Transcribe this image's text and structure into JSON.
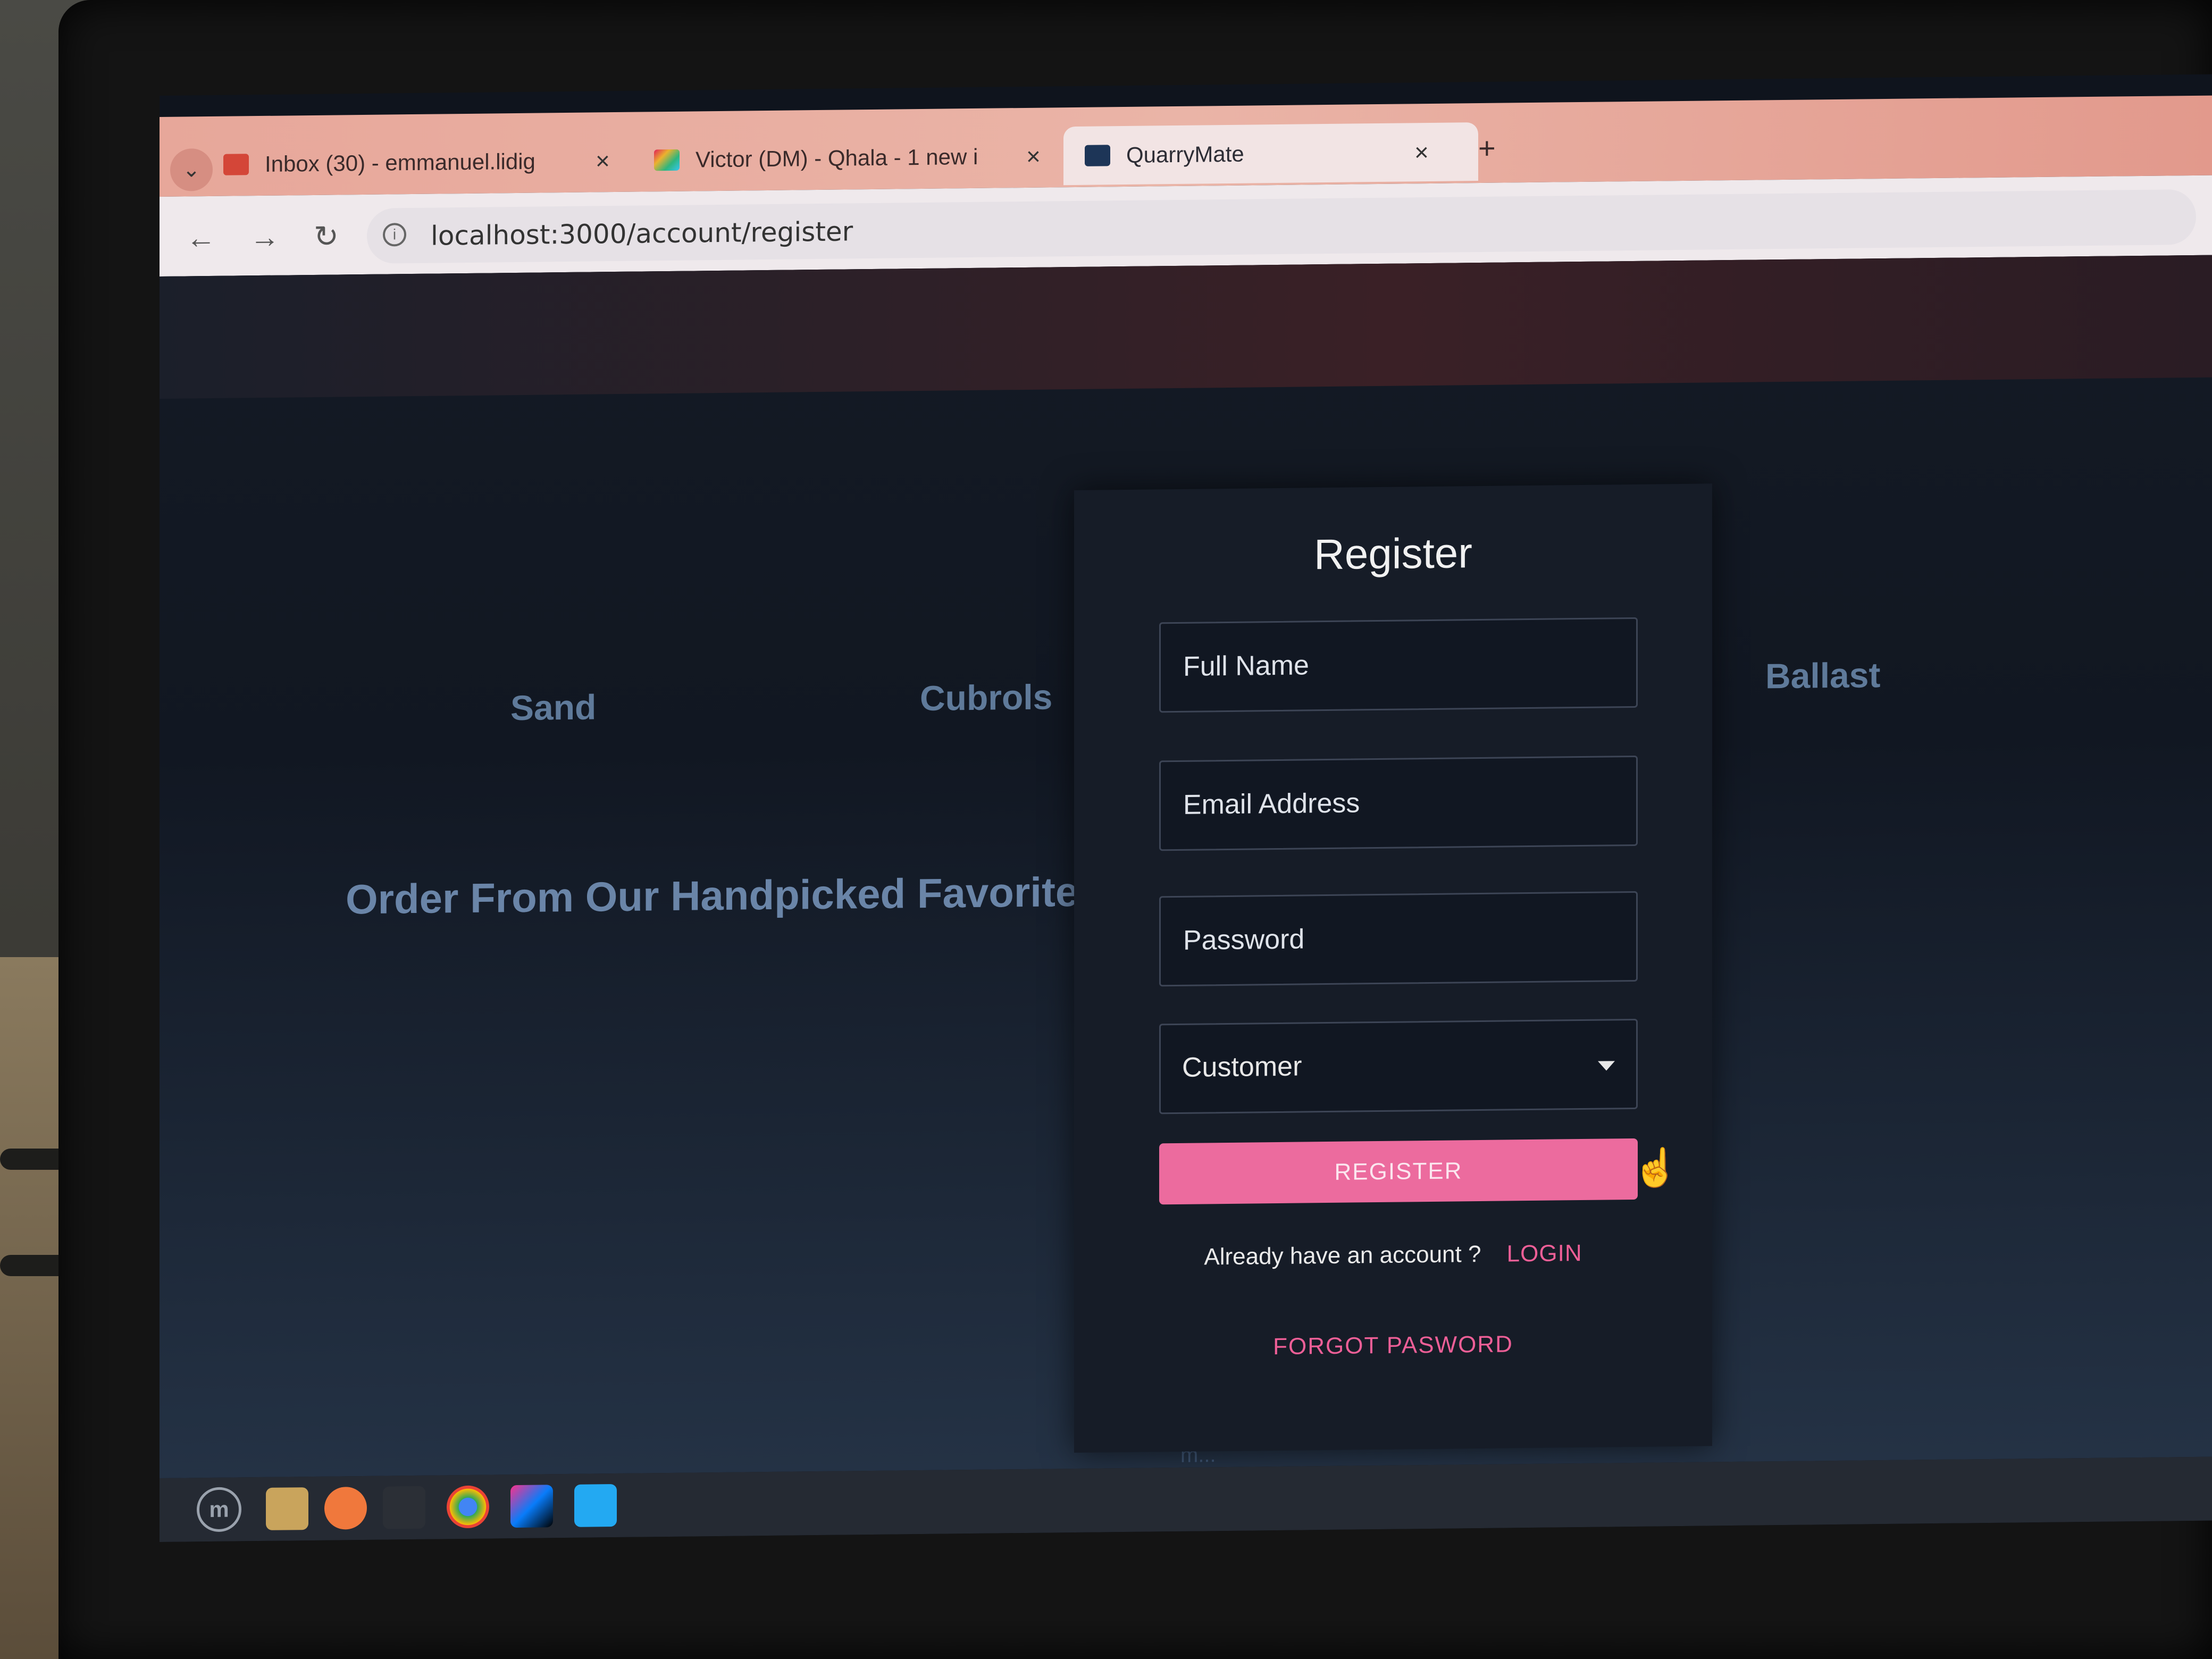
{
  "browser": {
    "tabs": [
      {
        "title": "Inbox (30) - emmanuel.lidig",
        "icon": "gmail-icon",
        "active": false
      },
      {
        "title": "Victor (DM) - Qhala - 1 new i",
        "icon": "slack-icon",
        "active": false
      },
      {
        "title": "QuarryMate",
        "icon": "site-favicon",
        "active": true
      }
    ],
    "close_glyph": "×",
    "new_tab_glyph": "+",
    "url": "localhost:3000/account/register"
  },
  "page": {
    "categories": [
      "Sand",
      "Cubrols",
      "Ballast"
    ],
    "hero_heading": "Order From Our Handpicked Favorites",
    "behind_text": "Our platform empowers clients to order m..."
  },
  "register": {
    "title": "Register",
    "full_name_placeholder": "Full Name",
    "email_placeholder": "Email Address",
    "password_placeholder": "Password",
    "role_selected": "Customer",
    "register_label": "REGISTER",
    "have_account_text": "Already have an account ?",
    "login_label": "LOGIN",
    "forgot_label": "FORGOT PASWORD"
  },
  "colors": {
    "accent_pink": "#ec6b9e",
    "link_pink": "#ee5f97",
    "modal_bg": "#161c27"
  }
}
